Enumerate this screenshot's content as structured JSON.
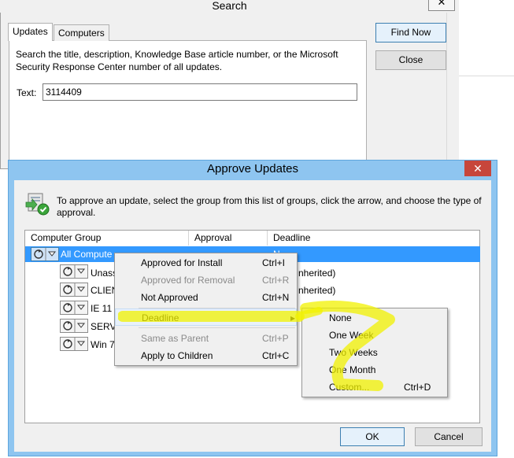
{
  "search_window": {
    "title": "Search",
    "close_glyph": "✕",
    "tabs": [
      {
        "label": "Updates"
      },
      {
        "label": "Computers"
      }
    ],
    "description": "Search the title, description, Knowledge Base article number, or the Microsoft Security Response Center number of all updates.",
    "text_label": "Text:",
    "text_value": "3114409",
    "find_now_label": "Find Now",
    "close_label": "Close"
  },
  "approve_window": {
    "title": "Approve Updates",
    "close_glyph": "✕",
    "icon": "approve-updates-icon",
    "description": "To approve an update, select the group from this list of groups, click the arrow, and choose the type of approval.",
    "columns": [
      "Computer Group",
      "Approval",
      "Deadline"
    ],
    "rows": [
      {
        "name": "All Compute",
        "approval": "",
        "deadline": "N"
      },
      {
        "name": "Unass",
        "approval": "",
        "deadline": "nherited)"
      },
      {
        "name": "CLIEN",
        "approval": "",
        "deadline": "nherited)"
      },
      {
        "name": "IE 11",
        "approval": "",
        "deadline": ""
      },
      {
        "name": "SERVE",
        "approval": "",
        "deadline": ""
      },
      {
        "name": "Win 7",
        "approval": "",
        "deadline": ""
      }
    ],
    "ok_label": "OK",
    "cancel_label": "Cancel"
  },
  "context_menu": {
    "items": [
      {
        "label": "Approved for Install",
        "shortcut": "Ctrl+I",
        "enabled": true
      },
      {
        "label": "Approved for Removal",
        "shortcut": "Ctrl+R",
        "enabled": false
      },
      {
        "label": "Not Approved",
        "shortcut": "Ctrl+N",
        "enabled": true
      },
      {
        "label": "Deadline",
        "shortcut": "▸",
        "enabled": true
      },
      {
        "label": "Same as Parent",
        "shortcut": "Ctrl+P",
        "enabled": false
      },
      {
        "label": "Apply to Children",
        "shortcut": "Ctrl+C",
        "enabled": true
      }
    ]
  },
  "deadline_submenu": {
    "items": [
      {
        "label": "None",
        "shortcut": ""
      },
      {
        "label": "One Week",
        "shortcut": ""
      },
      {
        "label": "Two Weeks",
        "shortcut": ""
      },
      {
        "label": "One Month",
        "shortcut": ""
      },
      {
        "label": "Custom...",
        "shortcut": "Ctrl+D"
      }
    ]
  },
  "annotation": {
    "highlight_color": "#f2f200"
  },
  "colors": {
    "selection": "#3399ff",
    "window_frame": "#8ec5f0",
    "close_red": "#c7463b"
  }
}
